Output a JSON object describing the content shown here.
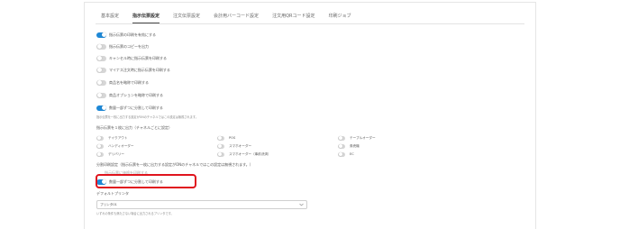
{
  "tabs": [
    "基本設定",
    "指示伝票設定",
    "注文伝票設定",
    "会計用バーコード設定",
    "注文用QRコード設定",
    "印刷ジョブ"
  ],
  "settings": [
    {
      "label": "指示伝票の印刷を有効にする",
      "on": true
    },
    {
      "label": "指示伝票のコピーを出力",
      "on": false
    },
    {
      "label": "キャンセル時に指示伝票を印刷する",
      "on": false
    },
    {
      "label": "マイナス注文時に指示伝票を印刷する",
      "on": false
    },
    {
      "label": "商品名を略称で印刷する",
      "on": false
    },
    {
      "label": "商品オプションを略称で印刷する",
      "on": false
    },
    {
      "label": "数量一部ずつに分割して印刷する",
      "on": true
    }
  ],
  "note1": "指示伝票を一枚に出力する設定がONのチャネルではこの設定は無視されます。",
  "single_sheet_title": "指示伝票を１枚に出力（チャネルごとに設定）",
  "channels": [
    {
      "label": "テイクアウト",
      "on": false
    },
    {
      "label": "POS",
      "on": false
    },
    {
      "label": "テーブルオーダー",
      "on": false
    },
    {
      "label": "ハンディオーダー",
      "on": false
    },
    {
      "label": "スマホオーダー",
      "on": false
    },
    {
      "label": "券売機",
      "on": false
    },
    {
      "label": "デリバリー",
      "on": false
    },
    {
      "label": "スマホオーダー（事前決済）",
      "on": false
    },
    {
      "label": "EC",
      "on": false
    }
  ],
  "split_title": "分割印刷設定（指示伝票を一枚に出力する設定がONのチャネルではこの設定は無視されます。）",
  "overlay_text": "指示伝票に価格を印刷する",
  "highlighted_setting": {
    "label": "数量一部ずつに分割して印刷する",
    "on": true
  },
  "default_printer_label": "デフォルトプリンタ",
  "printer_value": "プリンタ01",
  "printer_help": "いずれの条件も満たさない場合に出力されるプリンタです。",
  "colors": {
    "accent": "#1e88d6",
    "highlight": "#e0141e"
  }
}
